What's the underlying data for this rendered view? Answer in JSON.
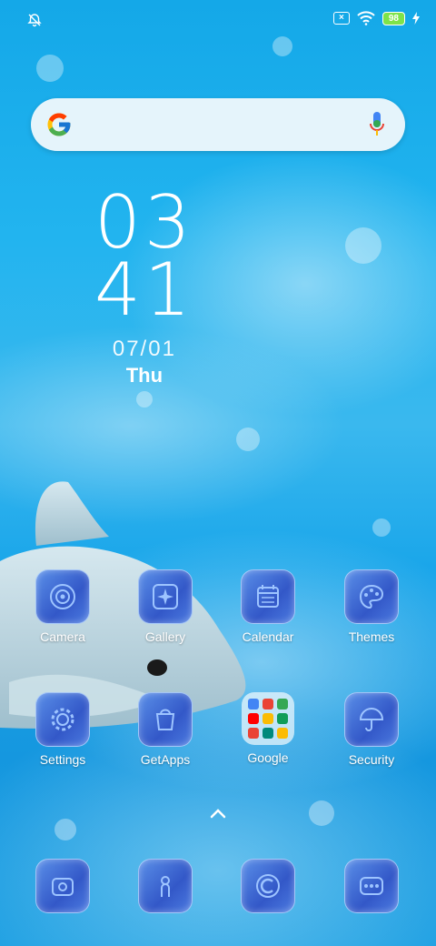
{
  "status_bar": {
    "left_icon": "alarm-off-icon",
    "sim_icon": "no-sim-icon",
    "wifi_icon": "wifi-icon",
    "battery_level": "98",
    "charging_icon": "charging-bolt-icon"
  },
  "search_bar": {
    "logo": "google-g-icon",
    "mic": "microphone-icon"
  },
  "clock": {
    "hour": "03",
    "minute": "41",
    "date": "07/01",
    "day": "Thu"
  },
  "apps_row1": [
    {
      "label": "Camera",
      "icon": "camera-icon"
    },
    {
      "label": "Gallery",
      "icon": "gallery-icon"
    },
    {
      "label": "Calendar",
      "icon": "calendar-icon"
    },
    {
      "label": "Themes",
      "icon": "themes-icon"
    }
  ],
  "apps_row2": [
    {
      "label": "Settings",
      "icon": "settings-icon"
    },
    {
      "label": "GetApps",
      "icon": "getapps-icon"
    },
    {
      "label": "Google",
      "icon": "google-folder-icon"
    },
    {
      "label": "Security",
      "icon": "security-icon"
    }
  ],
  "dock": [
    {
      "icon": "phone-icon"
    },
    {
      "icon": "contacts-icon"
    },
    {
      "icon": "browser-icon"
    },
    {
      "icon": "messages-icon"
    }
  ],
  "colors": {
    "wallpaper": "#1aa6ea",
    "icon_fill": "#3358c8",
    "battery": "#7ee34a"
  }
}
